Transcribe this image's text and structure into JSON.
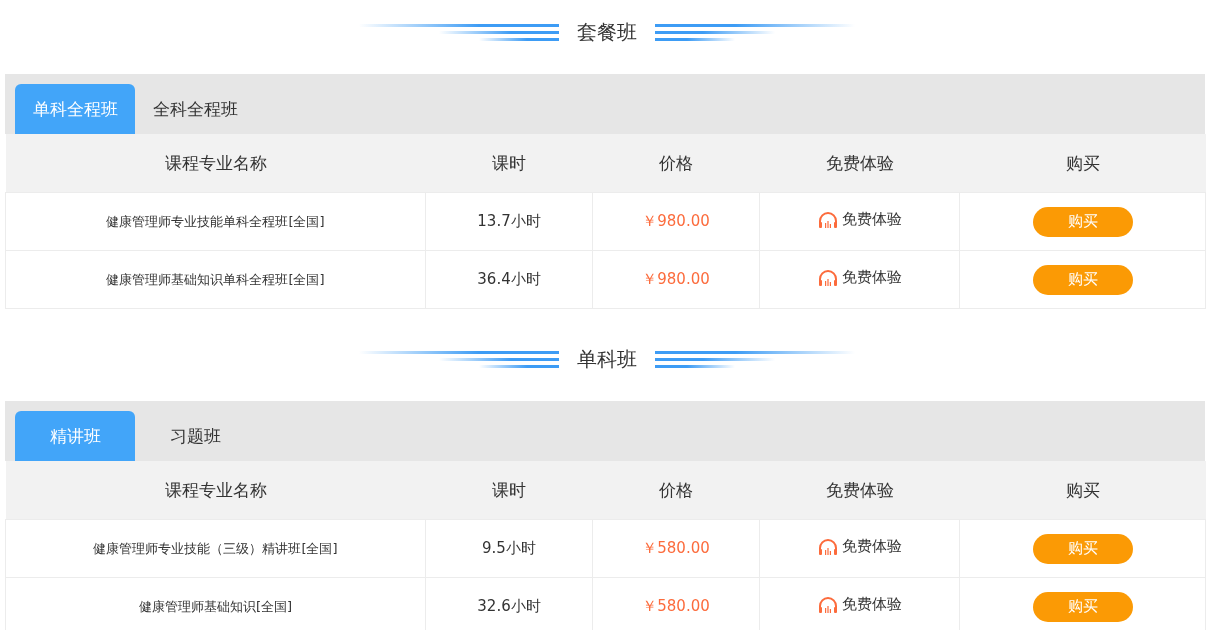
{
  "sections": [
    {
      "title": "套餐班",
      "tabs": [
        {
          "label": "单科全程班",
          "selected": true
        },
        {
          "label": "全科全程班",
          "selected": false
        }
      ],
      "columns": [
        "课程专业名称",
        "课时",
        "价格",
        "免费体验",
        "购买"
      ],
      "rows": [
        {
          "name": "健康管理师专业技能单科全程班[全国]",
          "hours": "13.7小时",
          "price": "￥980.00",
          "trial": "免费体验",
          "buy": "购买"
        },
        {
          "name": "健康管理师基础知识单科全程班[全国]",
          "hours": "36.4小时",
          "price": "￥980.00",
          "trial": "免费体验",
          "buy": "购买"
        }
      ]
    },
    {
      "title": "单科班",
      "tabs": [
        {
          "label": "精讲班",
          "selected": true
        },
        {
          "label": "习题班",
          "selected": false
        }
      ],
      "columns": [
        "课程专业名称",
        "课时",
        "价格",
        "免费体验",
        "购买"
      ],
      "rows": [
        {
          "name": "健康管理师专业技能（三级）精讲班[全国]",
          "hours": "9.5小时",
          "price": "￥580.00",
          "trial": "免费体验",
          "buy": "购买"
        },
        {
          "name": "健康管理师基础知识[全国]",
          "hours": "32.6小时",
          "price": "￥580.00",
          "trial": "免费体验",
          "buy": "购买"
        }
      ]
    }
  ]
}
